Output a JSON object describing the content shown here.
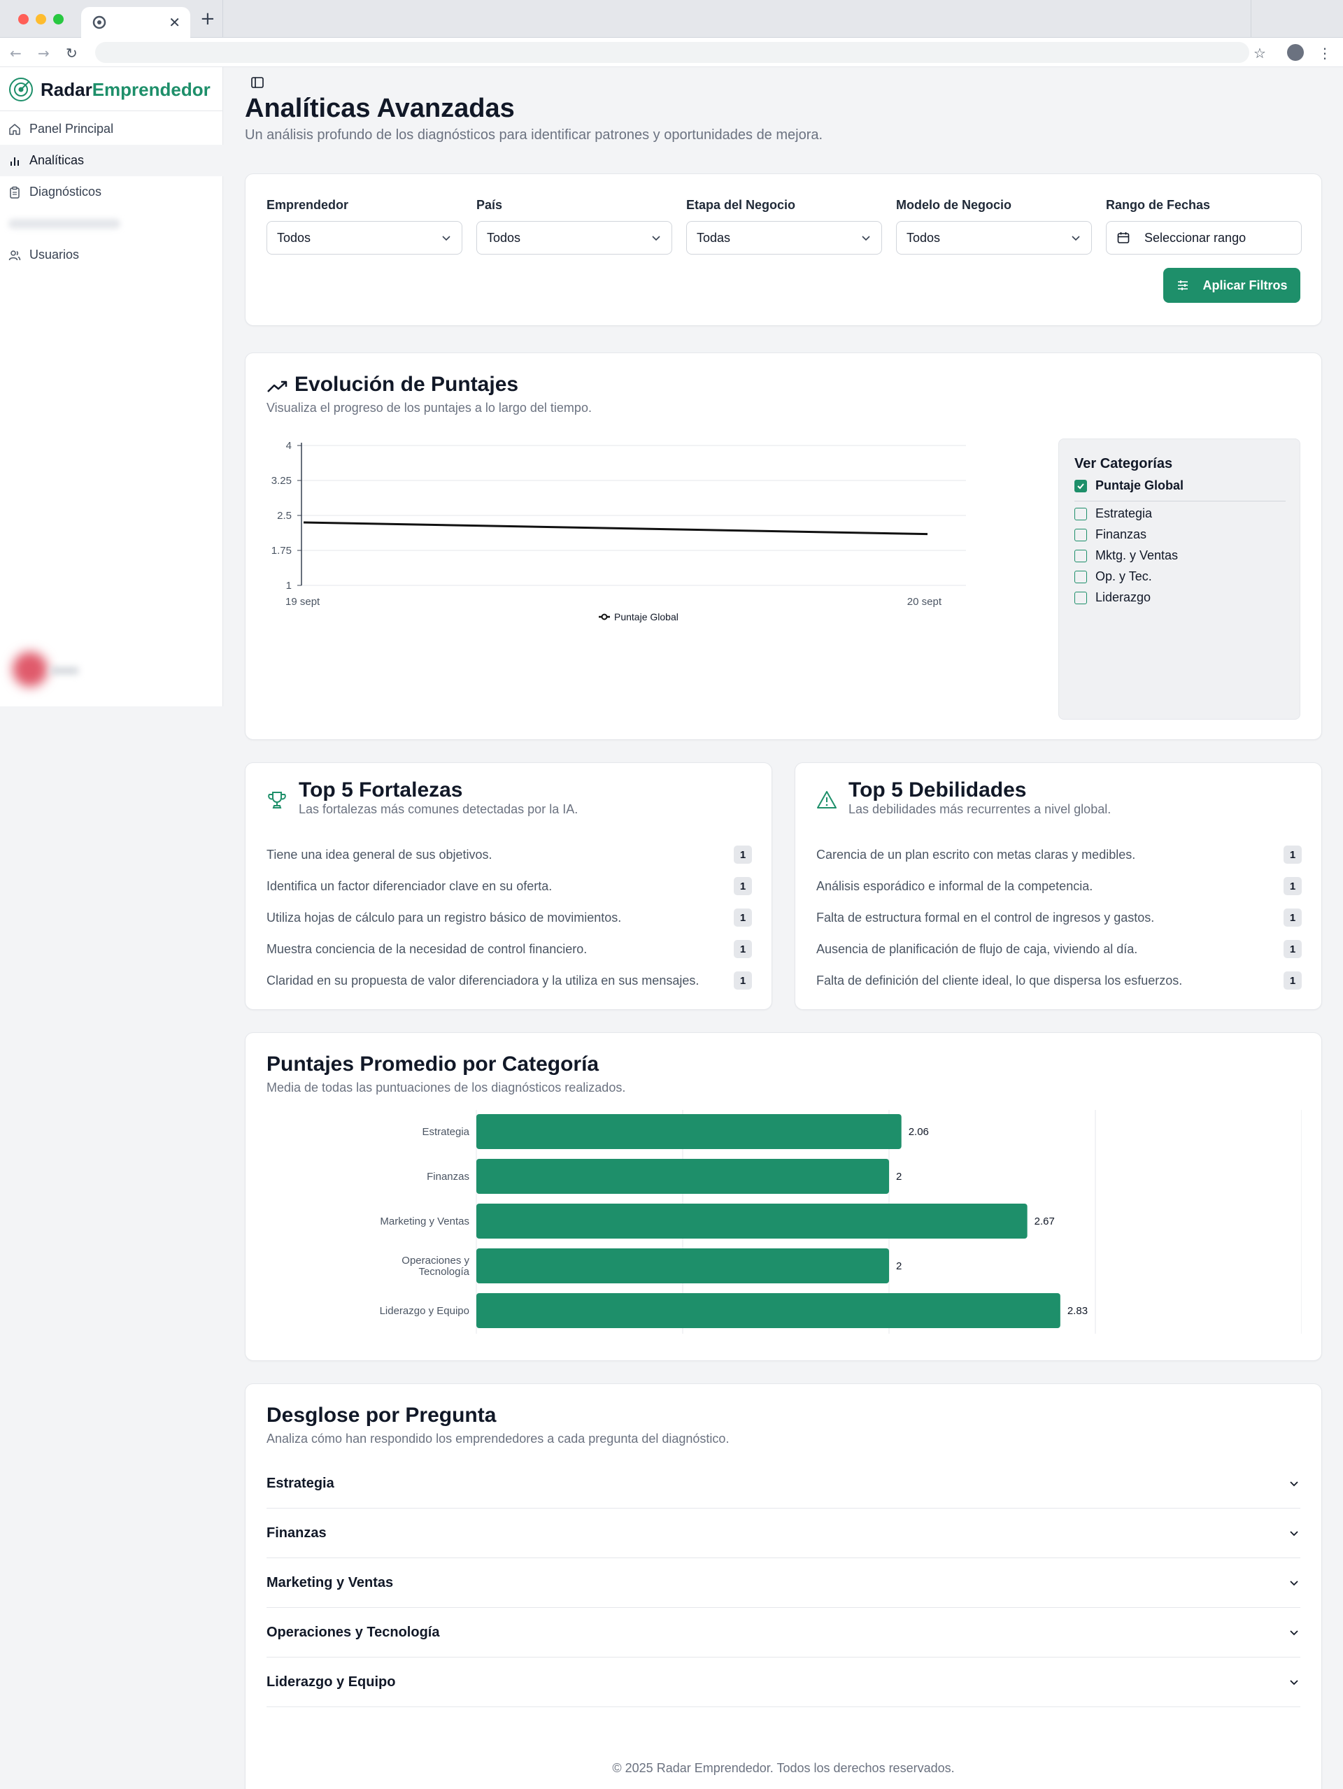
{
  "brand": {
    "name_part1": "Radar",
    "name_part2": "Emprendedor"
  },
  "sidebar": {
    "items": [
      {
        "label": "Panel Principal",
        "icon": "home-icon"
      },
      {
        "label": "Analíticas",
        "icon": "bar-chart-icon",
        "active": true
      },
      {
        "label": "Diagnósticos",
        "icon": "clipboard-icon"
      },
      {
        "label": "",
        "icon": "",
        "blurred": true
      },
      {
        "label": "Usuarios",
        "icon": "users-icon"
      }
    ]
  },
  "page": {
    "title": "Analíticas Avanzadas",
    "subtitle": "Un análisis profundo de los diagnósticos para identificar patrones y oportunidades de mejora."
  },
  "filters": {
    "emprendedor": {
      "label": "Emprendedor",
      "value": "Todos"
    },
    "pais": {
      "label": "País",
      "value": "Todos"
    },
    "etapa": {
      "label": "Etapa del Negocio",
      "value": "Todas"
    },
    "modelo": {
      "label": "Modelo de Negocio",
      "value": "Todos"
    },
    "rango": {
      "label": "Rango de Fechas",
      "value": "Seleccionar rango"
    },
    "apply_label": "Aplicar Filtros"
  },
  "evolution": {
    "title": "Evolución de Puntajes",
    "subtitle": "Visualiza el progreso de los puntajes a lo largo del tiempo.",
    "categories_panel": {
      "title": "Ver Categorías",
      "items": [
        {
          "label": "Puntaje Global",
          "checked": true
        },
        {
          "label": "Estrategia",
          "checked": false
        },
        {
          "label": "Finanzas",
          "checked": false
        },
        {
          "label": "Mktg. y Ventas",
          "checked": false
        },
        {
          "label": "Op. y Tec.",
          "checked": false
        },
        {
          "label": "Liderazgo",
          "checked": false
        }
      ]
    }
  },
  "strengths": {
    "title": "Top 5 Fortalezas",
    "subtitle": "Las fortalezas más comunes detectadas por la IA.",
    "items": [
      {
        "text": "Tiene una idea general de sus objetivos.",
        "count": "1"
      },
      {
        "text": "Identifica un factor diferenciador clave en su oferta.",
        "count": "1"
      },
      {
        "text": "Utiliza hojas de cálculo para un registro básico de movimientos.",
        "count": "1"
      },
      {
        "text": "Muestra conciencia de la necesidad de control financiero.",
        "count": "1"
      },
      {
        "text": "Claridad en su propuesta de valor diferenciadora y la utiliza en sus mensajes.",
        "count": "1"
      }
    ]
  },
  "weaknesses": {
    "title": "Top 5 Debilidades",
    "subtitle": "Las debilidades más recurrentes a nivel global.",
    "items": [
      {
        "text": "Carencia de un plan escrito con metas claras y medibles.",
        "count": "1"
      },
      {
        "text": "Análisis esporádico e informal de la competencia.",
        "count": "1"
      },
      {
        "text": "Falta de estructura formal en el control de ingresos y gastos.",
        "count": "1"
      },
      {
        "text": "Ausencia de planificación de flujo de caja, viviendo al día.",
        "count": "1"
      },
      {
        "text": "Falta de definición del cliente ideal, lo que dispersa los esfuerzos.",
        "count": "1"
      }
    ]
  },
  "averages": {
    "title": "Puntajes Promedio por Categoría",
    "subtitle": "Media de todas las puntuaciones de los diagnósticos realizados."
  },
  "breakdown": {
    "title": "Desglose por Pregunta",
    "subtitle": "Analiza cómo han respondido los emprendedores a cada pregunta del diagnóstico.",
    "items": [
      "Estrategia",
      "Finanzas",
      "Marketing y Ventas",
      "Operaciones y Tecnología",
      "Liderazgo y Equipo"
    ]
  },
  "footer": "© 2025 Radar Emprendedor. Todos los derechos reservados.",
  "colors": {
    "accent": "#1e8f6a",
    "line": "#111111"
  },
  "chart_data": [
    {
      "type": "line",
      "x": [
        "19 sept",
        "20 sept"
      ],
      "series": [
        {
          "name": "Puntaje Global",
          "values": [
            2.35,
            2.1
          ]
        }
      ],
      "ylim": [
        1,
        4
      ],
      "yticks": [
        "1",
        "1.75",
        "2.5",
        "3.25",
        "4"
      ],
      "legend": "bottom",
      "grid": true
    },
    {
      "type": "bar",
      "orientation": "horizontal",
      "categories": [
        "Estrategia",
        "Finanzas",
        "Marketing y Ventas",
        "Operaciones y Tecnología",
        "Liderazgo y Equipo"
      ],
      "category_labels": [
        [
          "Estrategia"
        ],
        [
          "Finanzas"
        ],
        [
          "Marketing y Ventas"
        ],
        [
          "Operaciones y",
          "Tecnología"
        ],
        [
          "Liderazgo y Equipo"
        ]
      ],
      "values": [
        2.06,
        2,
        2.67,
        2,
        2.83
      ],
      "value_labels": [
        "2.06",
        "2",
        "2.67",
        "2",
        "2.83"
      ],
      "xlim": [
        0,
        4
      ],
      "grid": true
    }
  ]
}
